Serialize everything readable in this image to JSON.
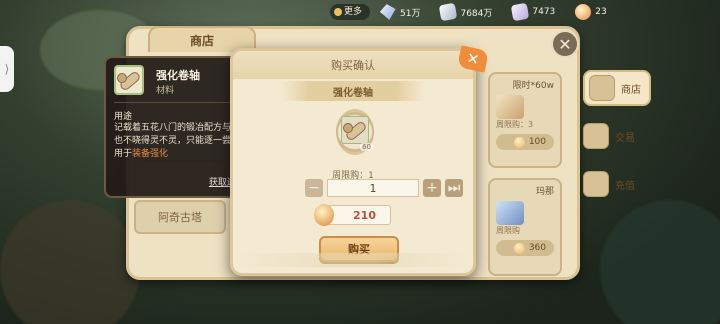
{
  "topbar": {
    "more_label": "更多",
    "currencies": [
      {
        "icon": "diamond-icon",
        "value": "51万"
      },
      {
        "icon": "silver-ingot-icon",
        "value": "7684万"
      },
      {
        "icon": "crystal-icon",
        "value": "7473"
      },
      {
        "icon": "peach-coin-icon",
        "value": "23"
      }
    ]
  },
  "shop": {
    "title": "商店",
    "list": [
      "阿奇古塔"
    ],
    "cards": [
      {
        "title": "限时*60w",
        "limit": "周限购：3",
        "price": "100"
      },
      {
        "title": "玛那",
        "limit": "周限购",
        "price": "360"
      }
    ],
    "sidebar": [
      "商店",
      "交易",
      "充值"
    ]
  },
  "tooltip": {
    "name": "强化卷轴",
    "type": "材料",
    "use_label": "用途",
    "desc_main": "记载着五花八门的锻冶配方与手法，也不晓得灵不灵，只能逐一尝试。可用于",
    "desc_highlight": "装备强化",
    "source_link": "获取途径>>"
  },
  "dialog": {
    "title": "购买确认",
    "item_name": "强化卷轴",
    "item_qty": "60",
    "weekly_limit": "周限购：1",
    "quantity": "1",
    "cost": "210",
    "buy_label": "购买",
    "close_symbol": "✕"
  },
  "colors": {
    "accent": "#f08d3d",
    "price": "#c54d3a",
    "highlight": "#e68a43"
  }
}
